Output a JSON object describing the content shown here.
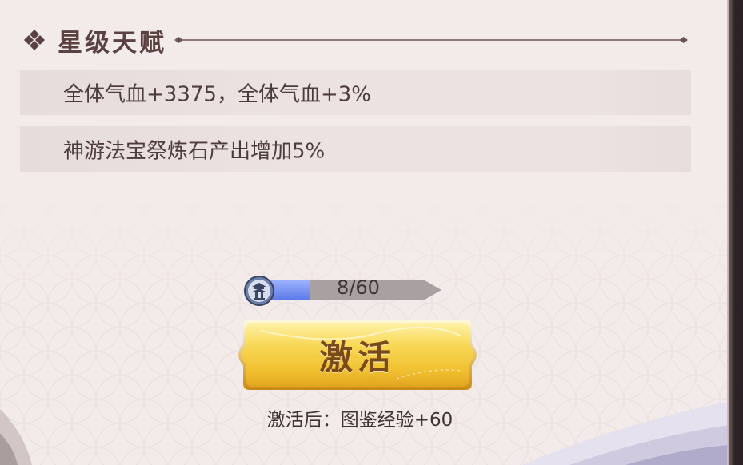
{
  "section": {
    "title": "星级天赋"
  },
  "talents": [
    {
      "text": "全体气血+3375，全体气血+3%"
    },
    {
      "text": "神游法宝祭炼石产出增加5%"
    }
  ],
  "progress": {
    "current": 8,
    "max": 60,
    "label": "8/60",
    "icon": "pagoda-badge-icon"
  },
  "activate": {
    "label": "激活"
  },
  "reward": {
    "text": "激活后：图鉴经验+60"
  },
  "colors": {
    "title": "#5a4242",
    "text": "#4e3c3d",
    "progress_fill": "#5a78e8",
    "button_gold": "#f6d04a"
  }
}
